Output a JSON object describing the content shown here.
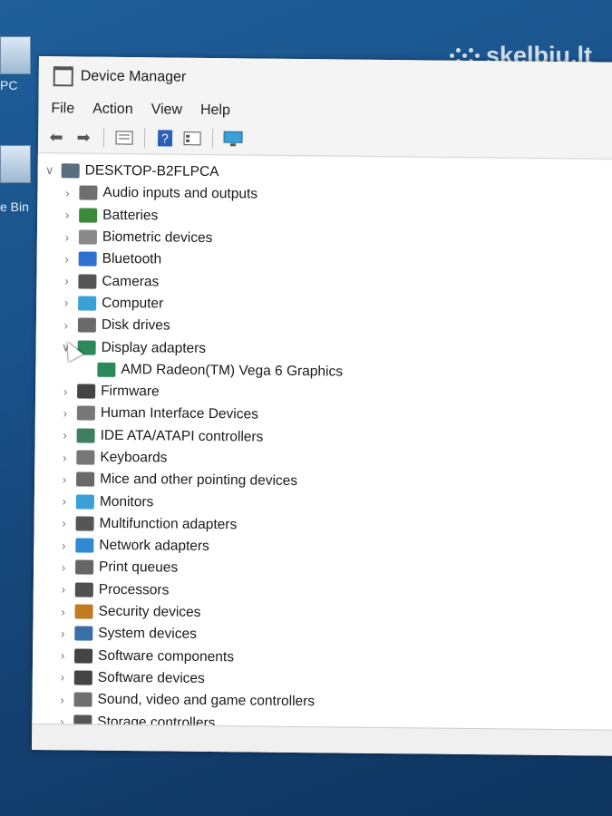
{
  "desktop": {
    "label_top": "PC",
    "label_bin": "e Bin",
    "watermark": "skelbiu.lt"
  },
  "window": {
    "title": "Device Manager",
    "menu": [
      "File",
      "Action",
      "View",
      "Help"
    ],
    "toolbar_icons": [
      "back-arrow-icon",
      "forward-arrow-icon",
      "properties-icon",
      "help-icon",
      "details-view-icon",
      "monitor-icon"
    ],
    "root": {
      "label": "DESKTOP-B2FLPCA",
      "expanded": true
    },
    "items": [
      {
        "label": "Audio inputs and outputs",
        "icon": "speaker-icon",
        "color": "#6f6f6f"
      },
      {
        "label": "Batteries",
        "icon": "battery-icon",
        "color": "#3a8a3a"
      },
      {
        "label": "Biometric devices",
        "icon": "fingerprint-icon",
        "color": "#8a8a8a"
      },
      {
        "label": "Bluetooth",
        "icon": "bluetooth-icon",
        "color": "#2f6fd0"
      },
      {
        "label": "Cameras",
        "icon": "camera-icon",
        "color": "#555555"
      },
      {
        "label": "Computer",
        "icon": "computer-icon",
        "color": "#3aa0d8"
      },
      {
        "label": "Disk drives",
        "icon": "disk-icon",
        "color": "#6a6a6a"
      },
      {
        "label": "Display adapters",
        "icon": "display-adapter-icon",
        "color": "#2a8a5a",
        "expanded": true,
        "children": [
          {
            "label": "AMD Radeon(TM) Vega 6 Graphics",
            "icon": "display-adapter-icon",
            "color": "#2a8a5a"
          }
        ]
      },
      {
        "label": "Firmware",
        "icon": "firmware-icon",
        "color": "#444444"
      },
      {
        "label": "Human Interface Devices",
        "icon": "hid-icon",
        "color": "#777777"
      },
      {
        "label": "IDE ATA/ATAPI controllers",
        "icon": "ide-controller-icon",
        "color": "#3f7f5f"
      },
      {
        "label": "Keyboards",
        "icon": "keyboard-icon",
        "color": "#777777"
      },
      {
        "label": "Mice and other pointing devices",
        "icon": "mouse-icon",
        "color": "#6a6a6a"
      },
      {
        "label": "Monitors",
        "icon": "monitor-icon",
        "color": "#3aa0d8"
      },
      {
        "label": "Multifunction adapters",
        "icon": "multifunction-icon",
        "color": "#555555"
      },
      {
        "label": "Network adapters",
        "icon": "network-icon",
        "color": "#2f8ad0"
      },
      {
        "label": "Print queues",
        "icon": "printer-icon",
        "color": "#666666"
      },
      {
        "label": "Processors",
        "icon": "processor-icon",
        "color": "#505050"
      },
      {
        "label": "Security devices",
        "icon": "security-icon",
        "color": "#c07a20"
      },
      {
        "label": "System devices",
        "icon": "system-devices-icon",
        "color": "#3a6fa8"
      },
      {
        "label": "Software components",
        "icon": "software-component-icon",
        "color": "#444444"
      },
      {
        "label": "Software devices",
        "icon": "software-device-icon",
        "color": "#444444"
      },
      {
        "label": "Sound, video and game controllers",
        "icon": "sound-icon",
        "color": "#6f6f6f"
      },
      {
        "label": "Storage controllers",
        "icon": "storage-icon",
        "color": "#555555"
      }
    ]
  }
}
